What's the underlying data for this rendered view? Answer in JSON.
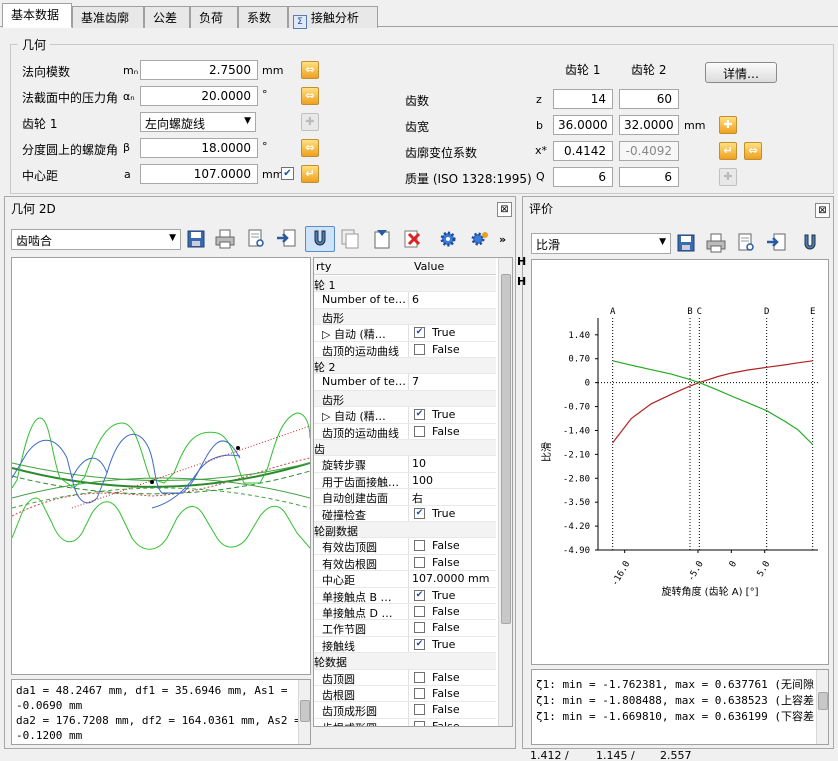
{
  "tabs": [
    {
      "label": "基本数据"
    },
    {
      "label": "基准齿廓"
    },
    {
      "label": "公差"
    },
    {
      "label": "负荷"
    },
    {
      "label": "系数"
    },
    {
      "label": "接触分析"
    }
  ],
  "geometry": {
    "title": "几何",
    "normal_module": {
      "label": "法向模数",
      "symbol": "mₙ",
      "value": "2.7500",
      "unit": "mm"
    },
    "pressure_angle": {
      "label": "法截面中的压力角",
      "symbol": "αₙ",
      "value": "20.0000",
      "unit": "°"
    },
    "gear1": {
      "label": "齿轮 1",
      "value": "左向螺旋线"
    },
    "helix_angle": {
      "label": "分度圆上的螺旋角",
      "symbol": "β",
      "value": "18.0000",
      "unit": "°"
    },
    "center_distance": {
      "label": "中心距",
      "symbol": "a",
      "value": "107.0000",
      "unit": "mm"
    },
    "col_gear1": "齿轮 1",
    "col_gear2": "齿轮 2",
    "details_button": "详情…",
    "teeth": {
      "label": "齿数",
      "symbol": "z",
      "v1": "14",
      "v2": "60"
    },
    "face_width": {
      "label": "齿宽",
      "symbol": "b",
      "v1": "36.0000",
      "v2": "32.0000",
      "unit": "mm"
    },
    "profile_shift": {
      "label": "齿廓变位系数",
      "symbol": "x*",
      "v1": "0.4142",
      "v2": "-0.4092"
    },
    "quality": {
      "label": "质量 (ISO 1328:1995)",
      "symbol": "Q",
      "v1": "6",
      "v2": "6"
    }
  },
  "geometry2d": {
    "title": "几何 2D",
    "view_select": "齿啮合",
    "prop_header_key": "rty",
    "prop_header_value": "Value",
    "props": [
      {
        "k": "轮 1",
        "v": "",
        "level": 0,
        "cat": true
      },
      {
        "k": "Number of te…",
        "v": "6",
        "level": 1
      },
      {
        "k": "齿形",
        "v": "",
        "level": 1,
        "cat": true
      },
      {
        "k": "▷ 自动 (精…",
        "v": "True",
        "level": 1,
        "check": true
      },
      {
        "k": "齿顶的运动曲线",
        "v": "False",
        "level": 1,
        "check": false
      },
      {
        "k": "轮 2",
        "v": "",
        "level": 0,
        "cat": true
      },
      {
        "k": "Number of te…",
        "v": "7",
        "level": 1
      },
      {
        "k": "齿形",
        "v": "",
        "level": 1,
        "cat": true
      },
      {
        "k": "▷ 自动 (精…",
        "v": "True",
        "level": 1,
        "check": true
      },
      {
        "k": "齿顶的运动曲线",
        "v": "False",
        "level": 1,
        "check": false
      },
      {
        "k": "齿",
        "v": "",
        "level": 0,
        "cat": true
      },
      {
        "k": "旋转步骤",
        "v": "10",
        "level": 1
      },
      {
        "k": "用于齿面接触…",
        "v": "100",
        "level": 1
      },
      {
        "k": "自动创建齿面",
        "v": "右",
        "level": 1
      },
      {
        "k": "碰撞检查",
        "v": "True",
        "level": 1,
        "check": true
      },
      {
        "k": "轮副数据",
        "v": "",
        "level": 0,
        "cat": true
      },
      {
        "k": "有效齿顶圆",
        "v": "False",
        "level": 1,
        "check": false
      },
      {
        "k": "有效齿根圆",
        "v": "False",
        "level": 1,
        "check": false
      },
      {
        "k": "中心距",
        "v": "107.0000 mm",
        "level": 1
      },
      {
        "k": "单接触点 B …",
        "v": "True",
        "level": 1,
        "check": true
      },
      {
        "k": "单接触点 D …",
        "v": "False",
        "level": 1,
        "check": false
      },
      {
        "k": "工作节圆",
        "v": "False",
        "level": 1,
        "check": false
      },
      {
        "k": "接触线",
        "v": "True",
        "level": 1,
        "check": true
      },
      {
        "k": "轮数据",
        "v": "",
        "level": 0,
        "cat": true
      },
      {
        "k": "齿顶圆",
        "v": "False",
        "level": 1,
        "check": false
      },
      {
        "k": "齿根圆",
        "v": "False",
        "level": 1,
        "check": false
      },
      {
        "k": "齿顶成形圆",
        "v": "False",
        "level": 1,
        "check": false
      },
      {
        "k": "齿根成形圆",
        "v": "False",
        "level": 1,
        "check": false
      }
    ],
    "output_lines": [
      "da1 = 48.2467 mm, df1 = 35.6946 mm, As1 =",
      "-0.0690 mm",
      "da2 = 176.7208 mm, df2 = 164.0361 mm, As2 =",
      "-0.1200 mm"
    ]
  },
  "evaluation": {
    "title": "评价",
    "select": "比滑",
    "header_stubs": [
      "H",
      "H"
    ],
    "output_lines": [
      "ζ1: min = -1.762381, max = 0.637761 (无间隙)",
      "ζ1: min = -1.808488, max = 0.638523 (上容差)",
      "ζ1: min = -1.669810, max = 0.636199 (下容差)"
    ]
  },
  "footer": {
    "left_text": "",
    "values": [
      "1.412 /",
      "1.145 /",
      "2.557"
    ]
  },
  "chart_data": {
    "type": "line",
    "xlabel": "旋转角度 (齿轮 A) [°]",
    "ylabel": "比滑",
    "xlim": [
      -20,
      13
    ],
    "ylim": [
      -4.9,
      1.6
    ],
    "x_ticks": [
      -16.0,
      -5.0,
      0,
      5.0
    ],
    "y_ticks": [
      1.4,
      0.7,
      0,
      -0.7,
      -1.4,
      -2.1,
      -2.8,
      -3.5,
      -4.2,
      -4.9
    ],
    "x_tick_labels": [
      "-16.0",
      "-5.0",
      "0",
      "5.0"
    ],
    "y_tick_labels": [
      "1.40",
      "0.70",
      "0",
      "-0.70",
      "-1.40",
      "-2.10",
      "-2.80",
      "-3.50",
      "-4.20",
      "-4.90"
    ],
    "markers": [
      {
        "name": "A",
        "x": -17.8
      },
      {
        "name": "B",
        "x": -6.2
      },
      {
        "name": "C",
        "x": -4.8
      },
      {
        "name": "D",
        "x": 5.3
      },
      {
        "name": "E",
        "x": 12.2
      }
    ],
    "series": [
      {
        "color": "#b22222",
        "x": [
          -17.8,
          -15,
          -12,
          -9,
          -6.2,
          -4.8,
          -2,
          0,
          2.5,
          5.3,
          8,
          10,
          12.2
        ],
        "y": [
          -1.76,
          -1.05,
          -0.62,
          -0.34,
          -0.1,
          0.0,
          0.18,
          0.28,
          0.37,
          0.45,
          0.52,
          0.58,
          0.64
        ]
      },
      {
        "color": "#22aa22",
        "x": [
          -17.8,
          -15,
          -12,
          -9,
          -6.2,
          -4.8,
          -2,
          0,
          2.5,
          5.3,
          8,
          10,
          12.2
        ],
        "y": [
          0.64,
          0.51,
          0.38,
          0.25,
          0.09,
          0.0,
          -0.22,
          -0.39,
          -0.59,
          -0.82,
          -1.13,
          -1.38,
          -1.81
        ]
      }
    ]
  }
}
